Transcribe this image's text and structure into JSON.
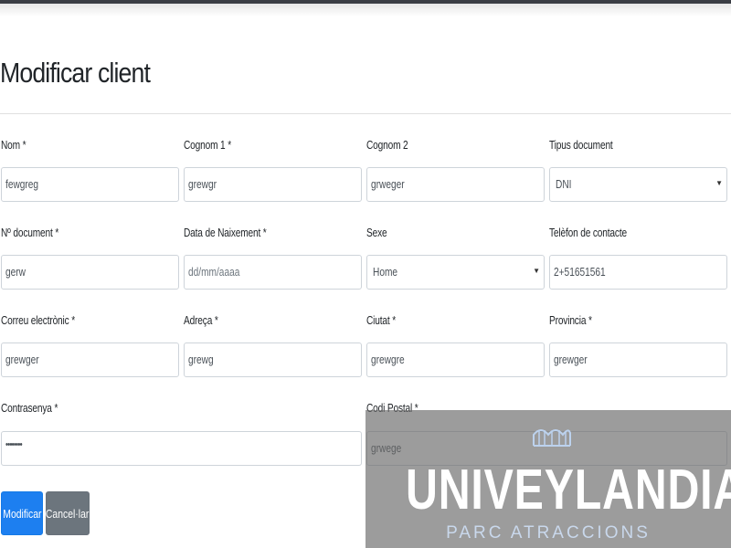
{
  "page": {
    "title": "Modificar client"
  },
  "form": {
    "nom": {
      "label": "Nom *",
      "value": "fewgreg"
    },
    "cognom1": {
      "label": "Cognom 1 *",
      "value": "grewgr"
    },
    "cognom2": {
      "label": "Cognom 2",
      "value": "grweger"
    },
    "tipus_document": {
      "label": "Tipus document",
      "value": "DNI"
    },
    "num_document": {
      "label": "Nº document *",
      "value": "gerw"
    },
    "data_naixement": {
      "label": "Data de Naixement *",
      "placeholder": "dd/mm/aaaa"
    },
    "sexe": {
      "label": "Sexe",
      "value": "Home"
    },
    "telefon": {
      "label": "Telèfon de contacte",
      "value": "2+51651561"
    },
    "correu": {
      "label": "Correu electrònic *",
      "value": "grewger"
    },
    "adreca": {
      "label": "Adreça *",
      "value": "grewg"
    },
    "ciutat": {
      "label": "Ciutat *",
      "value": "grewgre"
    },
    "provincia": {
      "label": "Provincia *",
      "value": "grewger"
    },
    "contrasenya": {
      "label": "Contrasenya *",
      "value": "••••••••"
    },
    "codi_postal": {
      "label": "Codi Postal *",
      "value": "grwege"
    }
  },
  "buttons": {
    "submit": "Modificar",
    "cancel": "Cancel·lar"
  },
  "watermark": {
    "name": "UNIVEYLANDIA",
    "subtitle": "PARC ATRACCIONS",
    "icon": "rollercoaster-icon",
    "text_color": "#ffffff",
    "subtitle_color": "#c9d8ec"
  },
  "colors": {
    "primary": "#1d7ff0",
    "secondary": "#6c757d"
  }
}
